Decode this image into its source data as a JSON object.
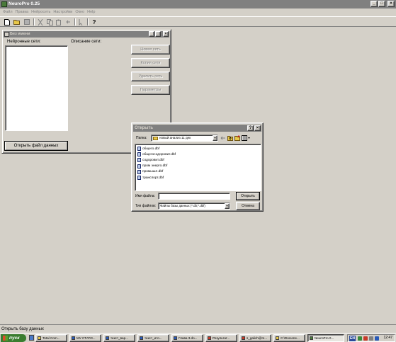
{
  "app": {
    "title": "NeuroPro 0.25"
  },
  "menu": [
    "Файл",
    "Правка",
    "Нейросеть",
    "Настройки",
    "Окно",
    "Help"
  ],
  "toolbar": {
    "icons": [
      "new-icon",
      "open-icon",
      "save-icon",
      "cut-icon",
      "copy-icon",
      "paste-icon",
      "undo-icon",
      "pointer-icon",
      "help-icon"
    ],
    "help_label": "?"
  },
  "child": {
    "title": "Без имени",
    "networks_label": "Нейронные сети:",
    "description_label": "Описание сети:",
    "new_net": "Новая сеть",
    "copy_net": "Копия сети",
    "delete_net": "Удалить сеть",
    "params": "Параметры",
    "open_file": "Открыть файл данных"
  },
  "dialog": {
    "title": "Открыть",
    "help_btn": "?",
    "close_btn": "×",
    "lookin_label": "Папка:",
    "lookin_value": "новый анализ 11 дек",
    "files": [
      "общего.dbf",
      "общегосодоровит.dbf",
      "содоровит.dbf",
      "пром энерго.dbf",
      "промышл.dbf",
      "транспорт.dbf"
    ],
    "filename_label": "Имя файла:",
    "filename_value": "",
    "filetype_label": "Тип файлов:",
    "filetype_value": "Файлы базы данных (*.db;*.dbf)",
    "open_btn": "Открыть",
    "cancel_btn": "Отмена"
  },
  "status": {
    "text": "Открыть базу данных"
  },
  "taskbar": {
    "start": "пуск",
    "tasks": [
      {
        "label": "Total Com...",
        "active": false
      },
      {
        "label": "МУ СТАТИ...",
        "active": false
      },
      {
        "label": "текст_вар...",
        "active": false
      },
      {
        "label": "текст_итo...",
        "active": false
      },
      {
        "label": "Глава 3.do...",
        "active": false
      },
      {
        "label": "Результат...",
        "active": false
      },
      {
        "label": "s_galich@m...",
        "active": false
      },
      {
        "label": "C:\\Docume...",
        "active": false
      },
      {
        "label": "NeuroPro 0...",
        "active": true
      }
    ],
    "lang": "EN",
    "clock": "12:47"
  }
}
